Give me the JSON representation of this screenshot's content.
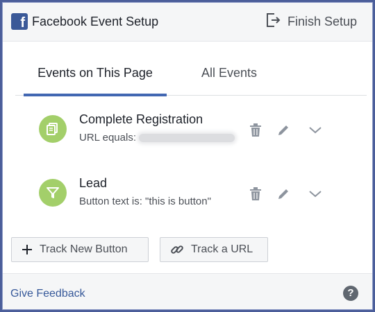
{
  "header": {
    "title": "Facebook Event Setup",
    "finish_label": "Finish Setup"
  },
  "tabs": [
    {
      "label": "Events on This Page",
      "active": true
    },
    {
      "label": "All Events",
      "active": false
    }
  ],
  "events": [
    {
      "name": "Complete Registration",
      "subtitle": "URL equals:",
      "icon": "document-icon"
    },
    {
      "name": "Lead",
      "subtitle": "Button text is: \"this is button\"",
      "icon": "filter-icon"
    }
  ],
  "buttons": {
    "track_button": "Track New Button",
    "track_url": "Track a URL"
  },
  "footer": {
    "feedback": "Give Feedback",
    "help": "?"
  },
  "colors": {
    "accent": "#4267b2",
    "event_icon_bg": "#a3cf6a",
    "brand": "#3b5998"
  }
}
